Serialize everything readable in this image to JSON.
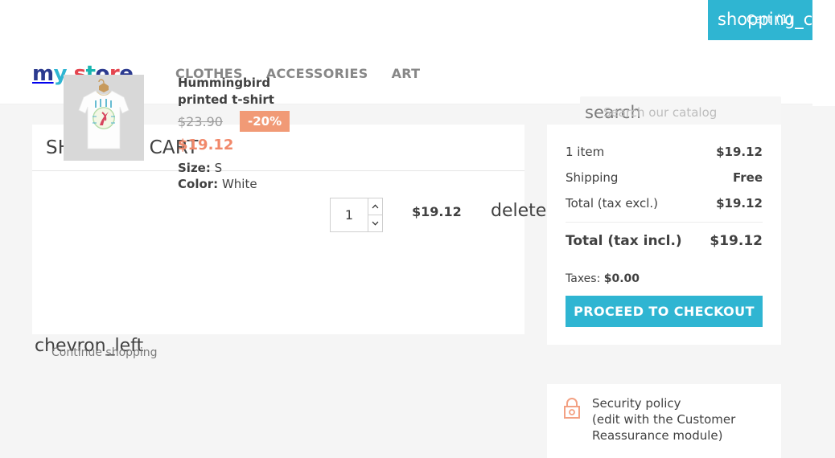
{
  "theme": {
    "accent": "#2fb5d2",
    "discount": "#f19a76",
    "page_bg": "#f5f5f5",
    "panel_bg": "#ffffff",
    "text": "#414141"
  },
  "header": {
    "cart": {
      "icon_ligature": "shopping_cart",
      "label": "Cart (1)"
    },
    "logo": {
      "part1": "my",
      "part2": " ",
      "part3": "store",
      "letters": [
        "m",
        "y",
        "s",
        "t",
        "o",
        "r",
        "e"
      ]
    },
    "menu": [
      {
        "label": "CLOTHES"
      },
      {
        "label": "ACCESSORIES"
      },
      {
        "label": "ART"
      }
    ],
    "search": {
      "icon_ligature": "search",
      "placeholder": "Search our catalog",
      "value": ""
    }
  },
  "cart": {
    "title": "SHOPPING CART",
    "item": {
      "name": "Hummingbird printed t-shirt",
      "regular_price": "$23.90",
      "discount_badge": "-20%",
      "current_price": "$19.12",
      "size_label": "Size:",
      "size_value": "S",
      "color_label": "Color:",
      "color_value": "White",
      "quantity": "1",
      "line_total": "$19.12",
      "delete_ligature": "delete"
    },
    "continue": {
      "icon_ligature": "chevron_left",
      "label": "Continue shopping"
    }
  },
  "summary": {
    "rows": [
      {
        "label": "1 item",
        "value": "$19.12"
      },
      {
        "label": "Shipping",
        "value": "Free"
      },
      {
        "label": "Total  (tax excl.)",
        "value": "$19.12"
      }
    ],
    "total_incl_label": "Total (tax incl.)",
    "total_incl_value": "$19.12",
    "taxes_label": "Taxes:",
    "taxes_value": "$0.00",
    "checkout_label": "PROCEED TO CHECKOUT"
  },
  "reassurance": {
    "icon": "lock-icon",
    "title": "Security policy",
    "subtitle": "(edit with the Customer Reassurance module)"
  }
}
